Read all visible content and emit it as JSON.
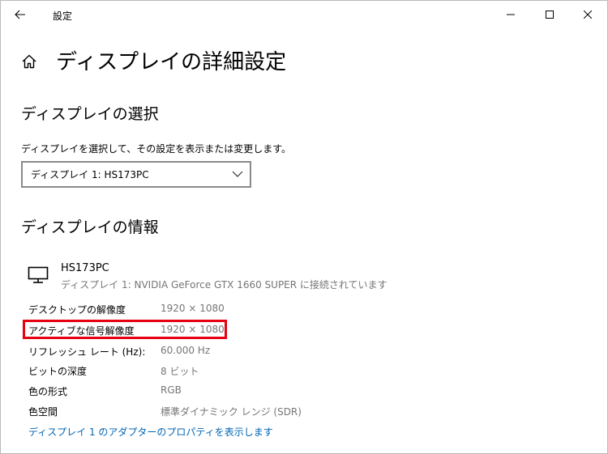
{
  "window": {
    "title": "設定"
  },
  "header": {
    "title": "ディスプレイの詳細設定"
  },
  "display_select": {
    "heading": "ディスプレイの選択",
    "description": "ディスプレイを選択して、その設定を表示または変更します。",
    "dropdown_value": "ディスプレイ 1: HS173PC"
  },
  "display_info": {
    "heading": "ディスプレイの情報",
    "monitor_name": "HS173PC",
    "monitor_sub": "ディスプレイ 1: NVIDIA GeForce GTX 1660 SUPER に接続されています",
    "rows": [
      {
        "label": "デスクトップの解像度",
        "value": "1920 × 1080"
      },
      {
        "label": "アクティブな信号解像度",
        "value": "1920 × 1080"
      },
      {
        "label": "リフレッシュ レート (Hz):",
        "value": "60.000 Hz"
      },
      {
        "label": "ビットの深度",
        "value": "8 ビット"
      },
      {
        "label": "色の形式",
        "value": "RGB"
      },
      {
        "label": "色空間",
        "value": "標準ダイナミック レンジ (SDR)"
      }
    ],
    "adapter_link": "ディスプレイ 1 のアダプターのプロパティを表示します"
  },
  "icons": {
    "back": "back-arrow-icon",
    "minimize": "minimize-icon",
    "maximize": "maximize-icon",
    "close": "close-icon",
    "home": "home-icon",
    "chevron": "chevron-down-icon",
    "monitor": "monitor-icon"
  },
  "colors": {
    "link": "#0066b4",
    "secondary_text": "#767676",
    "highlight_border": "#e60012"
  }
}
